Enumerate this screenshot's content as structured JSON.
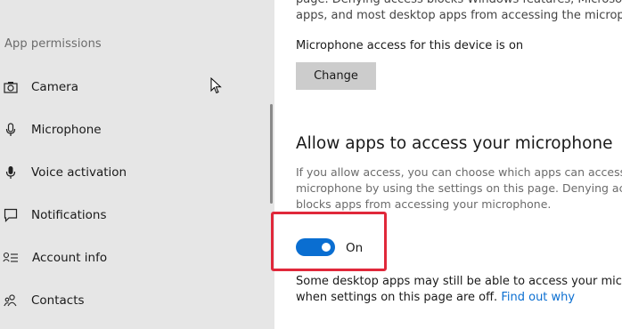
{
  "sidebar": {
    "heading": "App permissions",
    "items": [
      {
        "label": "Camera",
        "icon": "camera-icon"
      },
      {
        "label": "Microphone",
        "icon": "microphone-icon"
      },
      {
        "label": "Voice activation",
        "icon": "voice-activation-icon"
      },
      {
        "label": "Notifications",
        "icon": "notifications-icon"
      },
      {
        "label": "Account info",
        "icon": "account-info-icon"
      },
      {
        "label": "Contacts",
        "icon": "contacts-icon"
      }
    ]
  },
  "main": {
    "intro_line1": "page. Denying access blocks Windows features, Microsoft",
    "intro_line2": "apps, and most desktop apps from accessing the micropho",
    "device_status": "Microphone access for this device is on",
    "change_button": "Change",
    "section_title": "Allow apps to access your microphone",
    "section_desc_line1": "If you allow access, you can choose which apps can access y",
    "section_desc_line2": "microphone by using the settings on this page. Denying acc",
    "section_desc_line3": "blocks apps from accessing your microphone.",
    "toggle_state": "On",
    "footer_line1": "Some desktop apps may still be able to access your microph",
    "footer_line2_prefix": "when settings on this page are off.",
    "footer_link": "Find out why"
  },
  "colors": {
    "accent": "#0a6ed1",
    "highlight": "#e0283a",
    "sidebar_bg": "#e6e6e6"
  }
}
